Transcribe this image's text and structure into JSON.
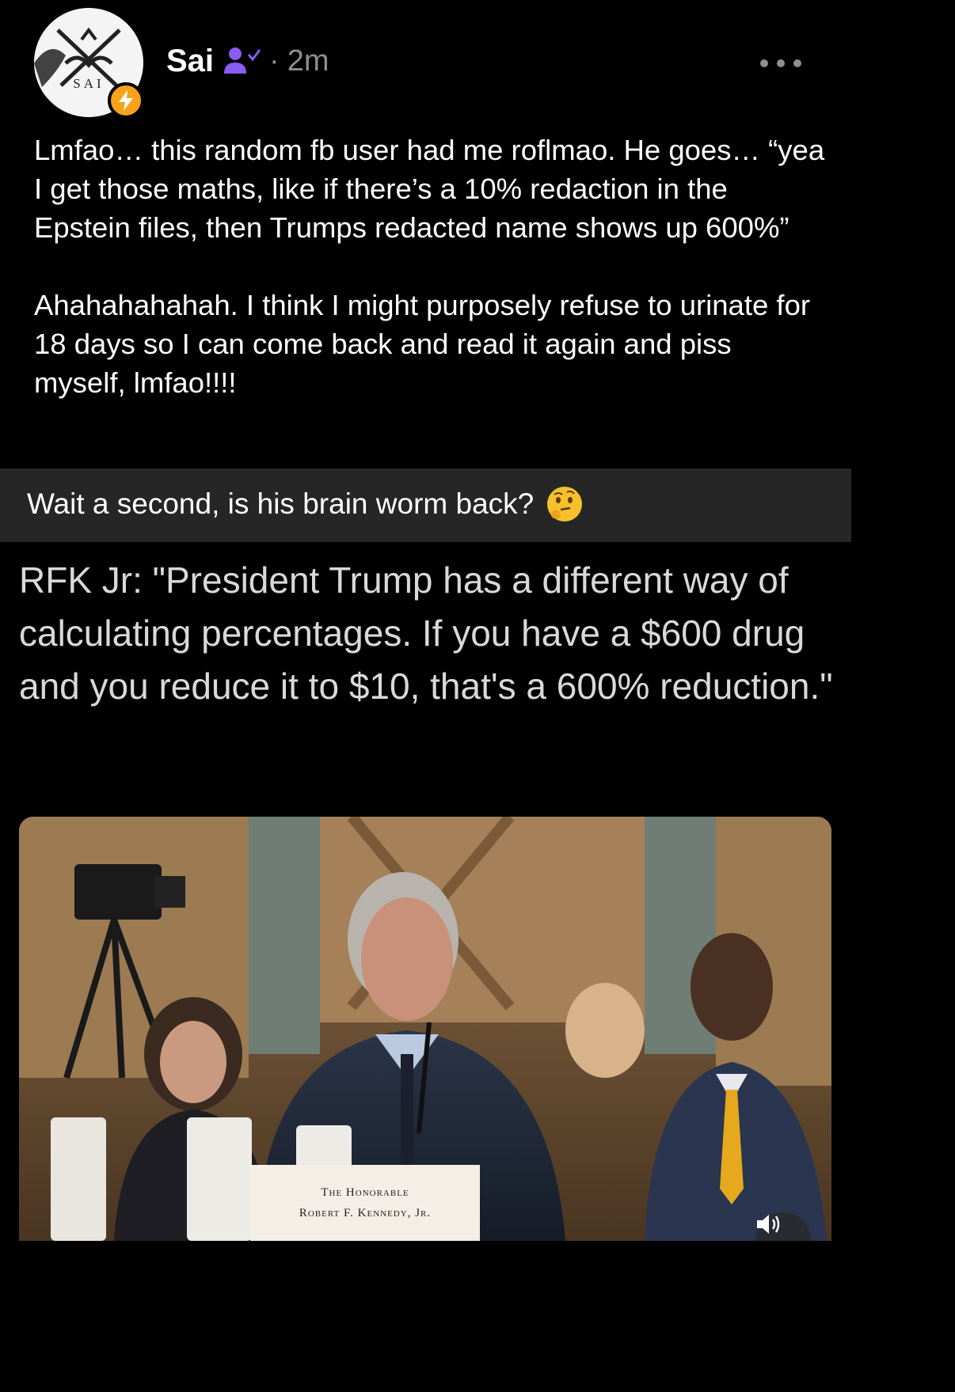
{
  "post": {
    "author": "Sai",
    "separator": "·",
    "time": "2m",
    "avatar_text": "SAI",
    "body": "Lmfao… this random fb user had me roflmao. He goes… “yea I get those maths, like if there’s a 10% redaction in the Epstein files, then Trumps redacted name shows up 600%”\n\nAhahahahahah. I think I might purposely refuse to urinate for 18 days so I can come back and read it again and piss myself, lmfao!!!!"
  },
  "embed": {
    "caption": "Wait a second, is his brain worm back?",
    "quote": "RFK Jr: \"President Trump has a different way of calculating percentages. If you have a $600 drug and you reduce it to $10, that's a 600% reduction.\"",
    "nameplate_line1": "The Honorable",
    "nameplate_line2": "Robert F. Kennedy, Jr."
  },
  "icons": {
    "badge": "lightning-bolt-icon",
    "verified": "person-check-icon",
    "more": "more-dots-icon",
    "emoji": "thinking-face-icon",
    "sound": "speaker-icon"
  },
  "colors": {
    "background": "#000000",
    "badge": "#f7a21b",
    "verified": "#8a5cf6",
    "muted": "#8e8e93",
    "caption_bg": "#262626"
  }
}
